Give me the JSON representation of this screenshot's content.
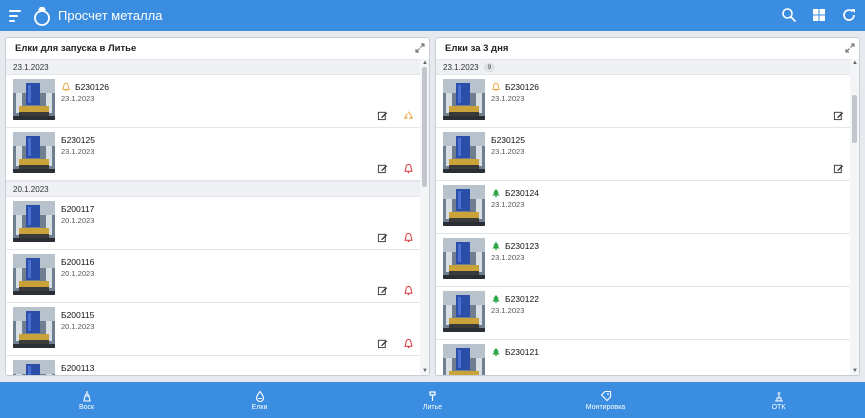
{
  "app": {
    "title": "Просчет металла",
    "accent": "#3a8de0",
    "actions": [
      "search-icon",
      "grid-icon",
      "refresh-icon"
    ]
  },
  "left_panel": {
    "title": "Елки для запуска в Литье",
    "groups": [
      {
        "date": "23.1.2023",
        "items": [
          {
            "name": "Б230126",
            "date": "23.1.2023",
            "state_icon": "bell-outline-orange",
            "action_icon": "recycle-orange"
          },
          {
            "name": "Б230125",
            "date": "23.1.2023",
            "state_icon": "",
            "action_icon": "bell-outline-red"
          }
        ]
      },
      {
        "date": "20.1.2023",
        "items": [
          {
            "name": "Б200117",
            "date": "20.1.2023",
            "state_icon": "",
            "action_icon": "bell-outline-red"
          },
          {
            "name": "Б200116",
            "date": "20.1.2023",
            "state_icon": "",
            "action_icon": "bell-outline-red"
          },
          {
            "name": "Б200115",
            "date": "20.1.2023",
            "state_icon": "",
            "action_icon": "bell-outline-red"
          },
          {
            "name": "Б200113",
            "date": "",
            "state_icon": "",
            "action_icon": ""
          }
        ]
      }
    ]
  },
  "right_panel": {
    "title": "Елки за 3 дня",
    "groups": [
      {
        "date": "23.1.2023",
        "count": "9",
        "items": [
          {
            "name": "Б230126",
            "date": "23.1.2023",
            "state_icon": "bell-outline-orange",
            "edit": true
          },
          {
            "name": "Б230125",
            "date": "23.1.2023",
            "state_icon": "",
            "edit": true
          },
          {
            "name": "Б230124",
            "date": "23.1.2023",
            "state_icon": "tree-green",
            "edit": false
          },
          {
            "name": "Б230123",
            "date": "23.1.2023",
            "state_icon": "tree-green",
            "edit": false
          },
          {
            "name": "Б230122",
            "date": "23.1.2023",
            "state_icon": "tree-green",
            "edit": false
          },
          {
            "name": "Б230121",
            "date": "",
            "state_icon": "tree-green",
            "edit": false
          }
        ]
      }
    ]
  },
  "bottom_nav": [
    {
      "label": "Воск",
      "icon": "wax-icon"
    },
    {
      "label": "Елки",
      "icon": "drop-icon"
    },
    {
      "label": "Литье",
      "icon": "hammer-icon"
    },
    {
      "label": "Монтировка",
      "icon": "tag-icon"
    },
    {
      "label": "ОТК",
      "icon": "inspect-icon"
    }
  ]
}
